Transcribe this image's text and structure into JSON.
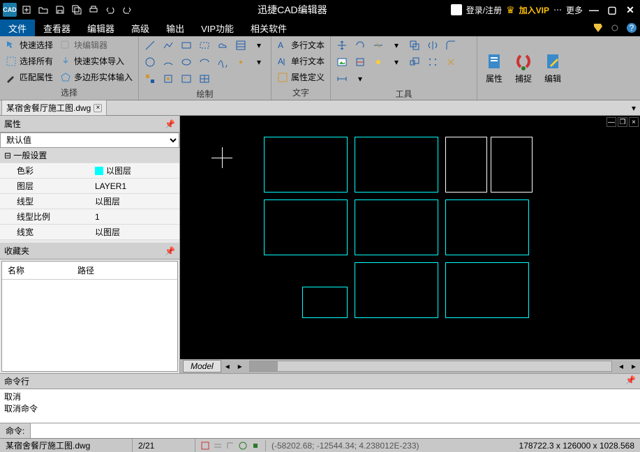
{
  "app": {
    "title": "迅捷CAD编辑器"
  },
  "titlebar_right": {
    "login": "登录/注册",
    "vip": "加入VIP",
    "more": "更多"
  },
  "menus": [
    "文件",
    "查看器",
    "编辑器",
    "高级",
    "输出",
    "VIP功能",
    "相关软件"
  ],
  "active_menu_index": 0,
  "ribbon": {
    "group_select": {
      "label": "选择",
      "items": [
        "快速选择",
        "块编辑器",
        "选择所有",
        "快速实体导入",
        "匹配属性",
        "多边形实体输入"
      ]
    },
    "group_draw": {
      "label": "绘制"
    },
    "group_text": {
      "label": "文字",
      "items": [
        "多行文本",
        "单行文本",
        "属性定义"
      ]
    },
    "group_tools": {
      "label": "工具"
    },
    "big_buttons": [
      "属性",
      "捕捉",
      "编辑"
    ]
  },
  "doc_tab": "某宿舍餐厅施工图.dwg",
  "panels": {
    "props_title": "属性",
    "default_value": "默认值",
    "general_header": "一般设置",
    "rows": [
      {
        "k": "色彩",
        "v": "以图层",
        "color": true
      },
      {
        "k": "图层",
        "v": "LAYER1"
      },
      {
        "k": "线型",
        "v": "以图层"
      },
      {
        "k": "线型比例",
        "v": "1"
      },
      {
        "k": "线宽",
        "v": "以图层"
      }
    ],
    "fav_title": "收藏夹",
    "fav_cols": [
      "名称",
      "路径"
    ]
  },
  "model_tab": "Model",
  "cmd": {
    "header": "命令行",
    "lines": [
      "取消",
      "取消命令"
    ],
    "prompt": "命令:"
  },
  "status": {
    "file": "某宿舍餐厅施工图.dwg",
    "page": "2/21",
    "coords": "(-58202.68; -12544.34; 4.238012E-233)",
    "dims": "178722.3 x 126000 x 1028.568"
  }
}
